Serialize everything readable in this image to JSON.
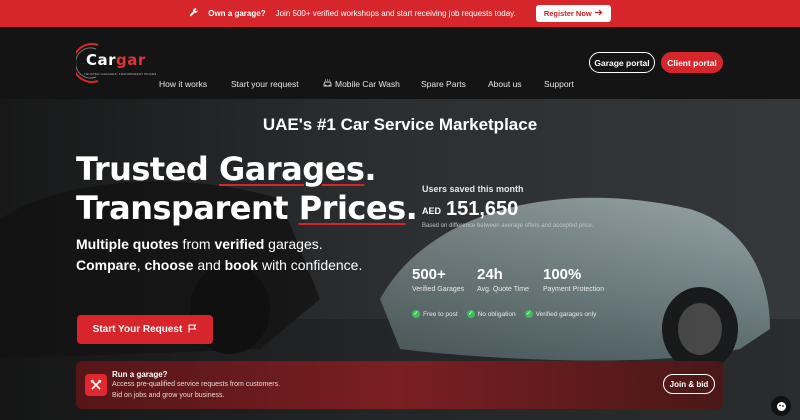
{
  "topbar": {
    "icon": "wrench-icon",
    "strong_text": "Own a garage?",
    "text": "Join 500+ verified workshops and start receiving job requests today.",
    "register_label": "Register Now",
    "register_icon": "arrow-right-icon"
  },
  "logo": {
    "text_a": "Car",
    "text_b": "gar",
    "arabic": "كار جار",
    "tagline": "TRUSTED GARAGES. TRANSPARENT PRICES"
  },
  "nav": {
    "items": [
      "How it works",
      "Start your request",
      "Mobile Car Wash",
      "Spare Parts",
      "About us",
      "Support"
    ],
    "car_wash_icon": "car-wash-icon",
    "garage_portal": "Garage portal",
    "client_portal": "Client portal"
  },
  "hero": {
    "marketplace_title": "UAE's #1 Car Service Marketplace",
    "headline_1a": "Trusted ",
    "headline_1b": "Garages",
    "headline_1c": ".",
    "headline_2a": "Transparent ",
    "headline_2b": "Prices",
    "headline_2c": ".",
    "sub_1": "Multiple quotes",
    "sub_2": " from ",
    "sub_3": "verified",
    "sub_4": " garages.",
    "sub_5": "Compare",
    "sub_6": ", ",
    "sub_7": "choose",
    "sub_8": " and ",
    "sub_9": "book",
    "sub_10": " with confidence.",
    "start_label": "Start Your Request",
    "start_icon": "flag-icon"
  },
  "savings": {
    "title": "Users saved this month",
    "currency": "AED",
    "amount": "151,650",
    "note": "Based on difference between average offers and accepted price."
  },
  "stats": [
    {
      "value": "500+",
      "label": "Verified Garages"
    },
    {
      "value": "24h",
      "label": "Avg. Quote Time"
    },
    {
      "value": "100%",
      "label": "Payment Protection"
    }
  ],
  "checks": [
    "Free to post",
    "No obligation",
    "Verified garages only"
  ],
  "garage_card": {
    "icon": "tools-icon",
    "title": "Run a garage?",
    "line_1": "Access pre-qualified service requests from customers.",
    "line_2": "Bid on jobs and grow your business.",
    "join_label": "Join & bid"
  },
  "chat_icon": "chat-icon",
  "colors": {
    "brand_red": "#d7262b",
    "check_green": "#3fbf5a"
  }
}
